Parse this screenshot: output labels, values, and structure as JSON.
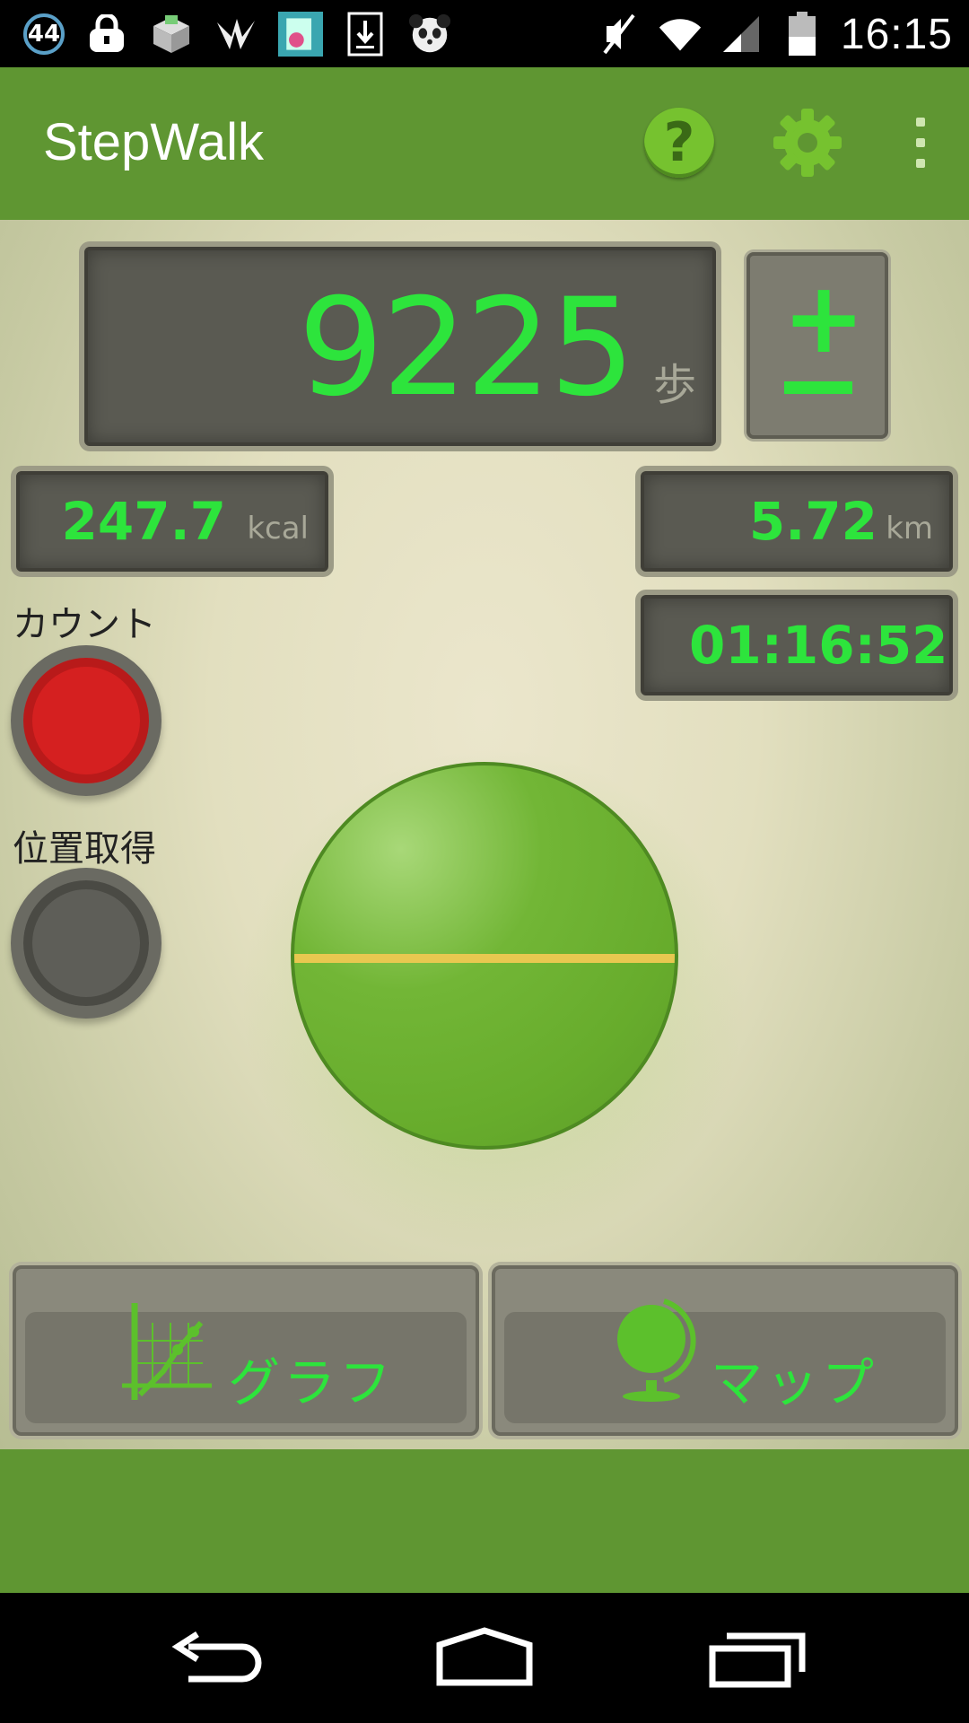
{
  "status_bar": {
    "notification_count": "44",
    "time": "16:15",
    "icons": [
      "notification-count-icon",
      "lock-icon",
      "box-app-icon",
      "bird-icon",
      "app-thumbnail-icon",
      "download-icon",
      "panda-icon"
    ],
    "right_icons": [
      "mute-icon",
      "wifi-icon",
      "signal-icon",
      "battery-icon"
    ]
  },
  "action_bar": {
    "title": "StepWalk",
    "help_label": "?",
    "color": "#5f9632"
  },
  "steps": {
    "value": "9225",
    "unit": "歩",
    "adjust_label": "+"
  },
  "metrics": {
    "kcal_value": "247.7",
    "kcal_unit": "kcal",
    "km_value": "5.72",
    "km_unit": "km",
    "elapsed": "01:16:52"
  },
  "controls": {
    "count_label": "カウント",
    "location_label": "位置取得"
  },
  "buttons": {
    "graph_label": "グラフ",
    "map_label": "マップ"
  },
  "colors": {
    "digit_green": "#2de43c",
    "ball_green": "#67ac2c",
    "record_red": "#d52020"
  }
}
